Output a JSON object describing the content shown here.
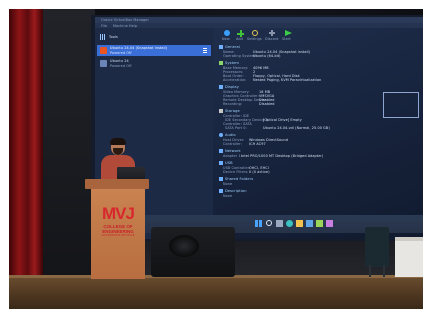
{
  "projection": {
    "window_title": "Oracle VirtualBox Manager",
    "menu": [
      "File",
      "Machine",
      "Help"
    ],
    "tools_label": "Tools",
    "vm_list": [
      {
        "name": "Ubuntu 24.04 (Snapshot install)",
        "state": "Powered Off"
      },
      {
        "name": "Ubuntu 24",
        "state": "Powered Off"
      }
    ],
    "toolbar": [
      "New",
      "Add",
      "Settings",
      "Discard",
      "Start"
    ],
    "sections": {
      "general": {
        "title": "General",
        "rows": [
          {
            "k": "Name:",
            "v": "Ubuntu 24.04 (Snapshot install)"
          },
          {
            "k": "Operating System:",
            "v": "Ubuntu (64-bit)"
          }
        ]
      },
      "system": {
        "title": "System",
        "rows": [
          {
            "k": "Base Memory:",
            "v": "4096 MB"
          },
          {
            "k": "Processors:",
            "v": "2"
          },
          {
            "k": "Boot Order:",
            "v": "Floppy, Optical, Hard Disk"
          },
          {
            "k": "Acceleration:",
            "v": "Nested Paging, KVM Paravirtualization"
          }
        ]
      },
      "display": {
        "title": "Display",
        "rows": [
          {
            "k": "Video Memory:",
            "v": "16 MB"
          },
          {
            "k": "Graphics Controller:",
            "v": "VMSVGA"
          },
          {
            "k": "Remote Desktop Server:",
            "v": "Disabled"
          },
          {
            "k": "Recording:",
            "v": "Disabled"
          }
        ]
      },
      "storage": {
        "title": "Storage",
        "rows": [
          {
            "k": "Controller: IDE",
            "v": ""
          },
          {
            "k": "IDE Secondary Device 0:",
            "v": "[Optical Drive] Empty"
          },
          {
            "k": "Controller: SATA",
            "v": ""
          },
          {
            "k": "SATA Port 0:",
            "v": "Ubuntu 24.04.vdi (Normal, 25.00 GB)"
          }
        ]
      },
      "audio": {
        "title": "Audio",
        "rows": [
          {
            "k": "Host Driver:",
            "v": "Windows DirectSound"
          },
          {
            "k": "Controller:",
            "v": "ICH AC97"
          }
        ]
      },
      "network": {
        "title": "Network",
        "rows": [
          {
            "k": "Adapter 1:",
            "v": "Intel PRO/1000 MT Desktop (Bridged Adapter)"
          }
        ]
      },
      "usb": {
        "title": "USB",
        "rows": [
          {
            "k": "USB Controller:",
            "v": "OHCI, EHCI"
          },
          {
            "k": "Device Filters:",
            "v": "0 (0 active)"
          }
        ]
      },
      "shared": {
        "title": "Shared Folders",
        "rows": [
          {
            "k": "None",
            "v": ""
          }
        ]
      },
      "description": {
        "title": "Description",
        "rows": [
          {
            "k": "None",
            "v": ""
          }
        ]
      }
    }
  },
  "podium": {
    "logo": "MVJ",
    "line1": "COLLEGE OF",
    "line2": "ENGINEERING",
    "line3": "AUTONOMOUS INSTITUTE"
  },
  "colors": {
    "curtain": "#7a0f12",
    "stage": "#5a4027",
    "podium": "#c47a4b",
    "logo_red": "#d8282d",
    "screen_bg": "#1a2a46"
  }
}
